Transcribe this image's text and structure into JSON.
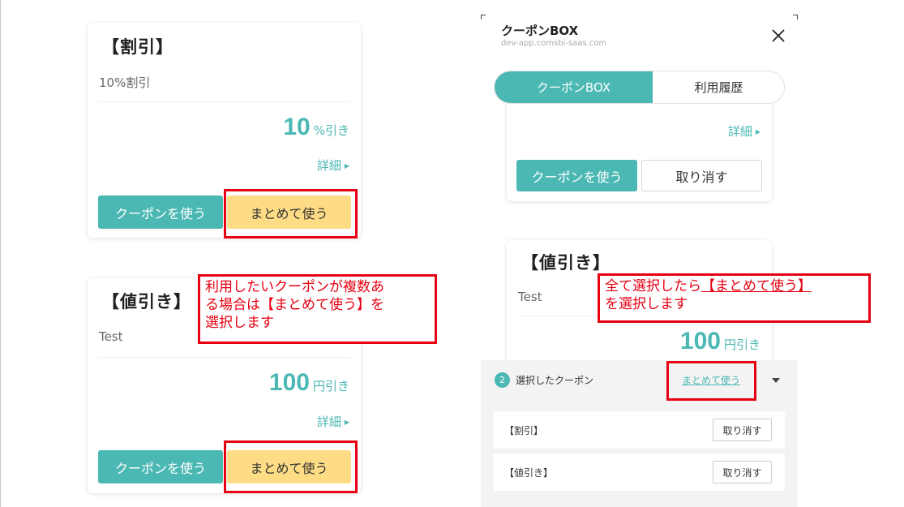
{
  "left": {
    "card1": {
      "title": "【割引】",
      "description": "10%割引",
      "amount_value": "10",
      "amount_unit": "%引き",
      "details_label": "詳細",
      "use_label": "クーポンを使う",
      "bulk_label": "まとめて使う"
    },
    "card2": {
      "title": "【値引き】",
      "description": "Test",
      "amount_value": "100",
      "amount_unit": "円引き",
      "details_label": "詳細",
      "use_label": "クーポンを使う",
      "bulk_label": "まとめて使う"
    },
    "callout_lines": [
      "利用したいクーポンが複数あ",
      "る場合は【まとめて使う】を",
      "選択します"
    ]
  },
  "right": {
    "modal_title": "クーポンBOX",
    "modal_url": "dev-app.comsbi-saas.com",
    "tabs": [
      {
        "label": "クーポンBOX",
        "active": true
      },
      {
        "label": "利用履歴",
        "active": false
      }
    ],
    "card_top": {
      "details_label": "詳細",
      "use_label": "クーポンを使う",
      "cancel_label": "取り消す"
    },
    "card_bottom": {
      "title": "【値引き】",
      "description": "Test",
      "amount_value": "100",
      "amount_unit": "円引き"
    },
    "callout": {
      "prefix": "全て選択したら",
      "highlight": "【まとめて使う】",
      "line2": "を選択します"
    },
    "selected_bar": {
      "count": "2",
      "label": "選択したクーポン",
      "bulk_link": "まとめて使う"
    },
    "selected_items": [
      {
        "name": "【割引】",
        "cancel_label": "取り消す"
      },
      {
        "name": "【値引き】",
        "cancel_label": "取り消す"
      }
    ]
  },
  "colors": {
    "accent": "#4cb8b3",
    "bulk_button": "#fddc85",
    "annotation_red": "#e60012"
  }
}
